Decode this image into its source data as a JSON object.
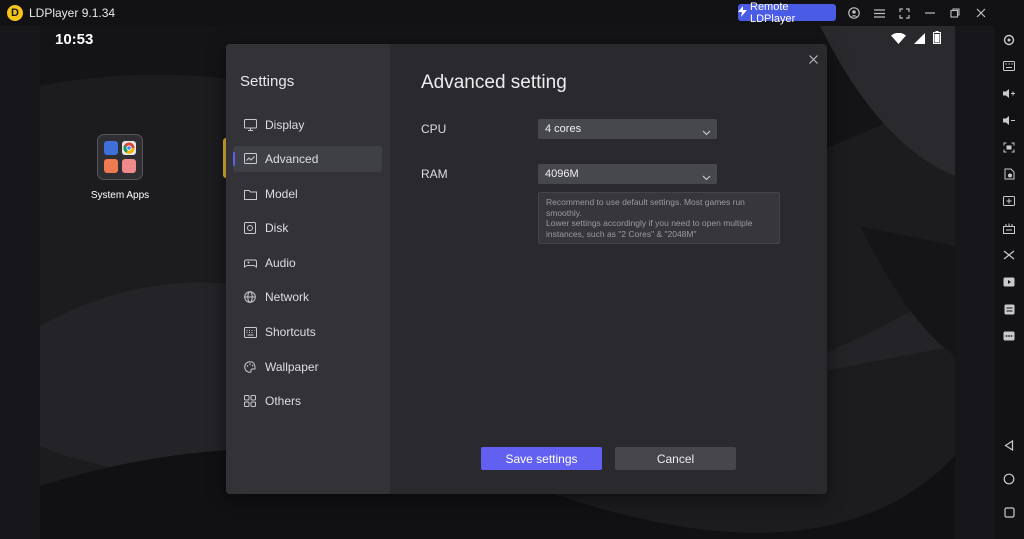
{
  "titlebar": {
    "app_title": "LDPlayer 9.1.34",
    "logo_glyph": "D",
    "remote_label": "Remote LDPlayer",
    "icons": [
      "account-icon",
      "menu-icon",
      "fullscreen-icon",
      "minimize-icon",
      "restore-icon",
      "close-icon"
    ]
  },
  "status": {
    "time": "10:53"
  },
  "desktop": {
    "folder_label": "System Apps"
  },
  "settings": {
    "title": "Settings",
    "nav": [
      {
        "label": "Display",
        "icon": "monitor-icon"
      },
      {
        "label": "Advanced",
        "icon": "chart-icon",
        "active": true
      },
      {
        "label": "Model",
        "icon": "folder-icon"
      },
      {
        "label": "Disk",
        "icon": "disk-icon"
      },
      {
        "label": "Audio",
        "icon": "gamepad-icon"
      },
      {
        "label": "Network",
        "icon": "globe-icon"
      },
      {
        "label": "Shortcuts",
        "icon": "keyboard-icon"
      },
      {
        "label": "Wallpaper",
        "icon": "palette-icon"
      },
      {
        "label": "Others",
        "icon": "grid-icon"
      }
    ],
    "content_title": "Advanced setting",
    "cpu_label": "CPU",
    "cpu_value": "4 cores",
    "ram_label": "RAM",
    "ram_value": "4096M",
    "hint_line1": "Recommend to use default settings. Most games run smoothly.",
    "hint_line2": "Lower settings accordingly if you need to open multiple instances, such as \"2 Cores\" & \"2048M\"",
    "save_label": "Save settings",
    "cancel_label": "Cancel"
  },
  "colors": {
    "accent": "#6260f0",
    "remote_button": "#4a5be6",
    "dialog_bg": "#2a2a2e",
    "nav_bg": "#323237"
  }
}
